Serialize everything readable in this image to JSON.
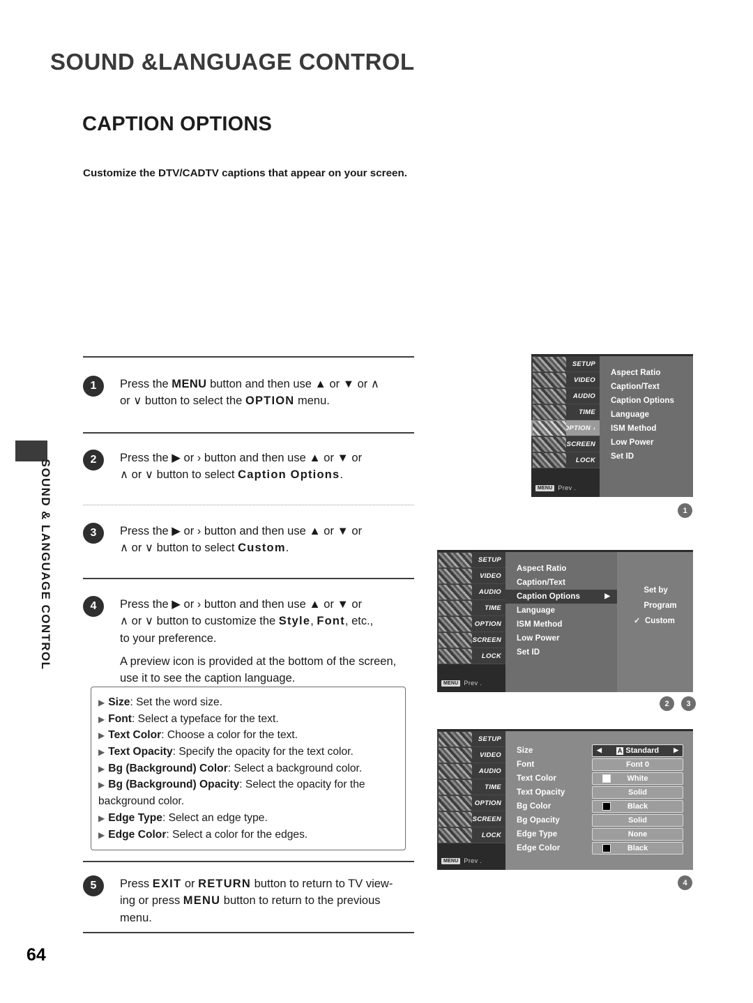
{
  "page": {
    "chapter_title": "SOUND &LANGUAGE CONTROL",
    "section_title": "CAPTION OPTIONS",
    "intro": "Customize the DTV/CADTV captions that appear on your screen.",
    "side_tab_label": "SOUND & LANGUAGE CONTROL",
    "page_number": "64"
  },
  "steps": [
    {
      "number": "1",
      "line1_a": "Press the ",
      "line1_b": "MENU",
      "line1_c": " button and then use ▲ or ▼  or  ∧",
      "line2_a": "or ∨  button to select the ",
      "line2_b": "OPTION",
      "line2_c": " menu."
    },
    {
      "number": "2",
      "line1_a": "Press the ▶  or  ›  button and then use ▲ or ▼  or",
      "line2_a": "∧ or ∨  button to select ",
      "line2_b": "Caption Options",
      "line2_c": "."
    },
    {
      "number": "3",
      "line1_a": "Press the ▶  or  ›  button and then use ▲ or ▼  or",
      "line2_a": "∧ or ∨  button to select ",
      "line2_b": "Custom",
      "line2_c": "."
    },
    {
      "number": "4",
      "line1_a": "Press the ▶  or  ›  button and then use ▲ or ▼  or",
      "line2_a": "∧ or ∨  button to customize the ",
      "line2_b": "Style",
      "line2_c": ", ",
      "line2_d": "Font",
      "line2_e": ", etc.,",
      "line3": "to your preference.",
      "line4": "A preview icon is provided at the bottom of the screen, use it to see the caption language."
    },
    {
      "number": "5",
      "line1_a": "Press ",
      "line1_b": "EXIT",
      "line1_c": " or ",
      "line1_d": "RETURN",
      "line1_e": " button to return to TV view-",
      "line2_a": "ing or press ",
      "line2_b": "MENU",
      "line2_c": " button to return to the previous",
      "line3": "menu."
    }
  ],
  "bullets": [
    {
      "term": "Size",
      "desc": ": Set the word size."
    },
    {
      "term": "Font",
      "desc": ": Select a typeface for the text."
    },
    {
      "term": "Text Color",
      "desc": ": Choose a color for the text."
    },
    {
      "term": "Text Opacity",
      "desc": ": Specify the opacity for the text color."
    },
    {
      "term": "Bg (Background) Color",
      "desc": ": Select a background color."
    },
    {
      "term": "Bg (Background) Opacity",
      "desc": ": Select the opacity for the background color."
    },
    {
      "term": "Edge Type",
      "desc": ": Select an edge type."
    },
    {
      "term": "Edge Color",
      "desc": ": Select a color for the edges."
    }
  ],
  "osd": {
    "sidebar": [
      {
        "label": "SETUP"
      },
      {
        "label": "VIDEO"
      },
      {
        "label": "AUDIO"
      },
      {
        "label": "TIME"
      },
      {
        "label": "OPTION"
      },
      {
        "label": "SCREEN"
      },
      {
        "label": "LOCK"
      }
    ],
    "prev_key": "MENU",
    "prev_label": "Prev .",
    "option_menu": [
      "Aspect Ratio",
      "Caption/Text",
      "Caption Options",
      "Language",
      "ISM Method",
      "Low Power",
      "Set ID"
    ],
    "caption_options_submenu": [
      {
        "label": "Set by Program",
        "checked": ""
      },
      {
        "label": "Custom",
        "checked": "✓"
      }
    ],
    "custom_settings": [
      {
        "label": "Size",
        "value": "Standard",
        "active": true,
        "swatch": "",
        "arrows": true,
        "aicon": "A"
      },
      {
        "label": "Font",
        "value": "Font  0",
        "active": false,
        "swatch": "",
        "arrows": false,
        "aicon": ""
      },
      {
        "label": "Text Color",
        "value": "White",
        "active": false,
        "swatch": "white",
        "arrows": false,
        "aicon": ""
      },
      {
        "label": "Text Opacity",
        "value": "Solid",
        "active": false,
        "swatch": "",
        "arrows": false,
        "aicon": ""
      },
      {
        "label": "Bg Color",
        "value": "Black",
        "active": false,
        "swatch": "black",
        "arrows": false,
        "aicon": ""
      },
      {
        "label": "Bg Opacity",
        "value": "Solid",
        "active": false,
        "swatch": "",
        "arrows": false,
        "aicon": ""
      },
      {
        "label": "Edge Type",
        "value": "None",
        "active": false,
        "swatch": "",
        "arrows": false,
        "aicon": ""
      },
      {
        "label": "Edge Color",
        "value": "Black",
        "active": false,
        "swatch": "black",
        "arrows": false,
        "aicon": ""
      }
    ],
    "badges": {
      "one": "1",
      "two": "2",
      "three": "3",
      "four": "4"
    },
    "caret": "▶"
  }
}
